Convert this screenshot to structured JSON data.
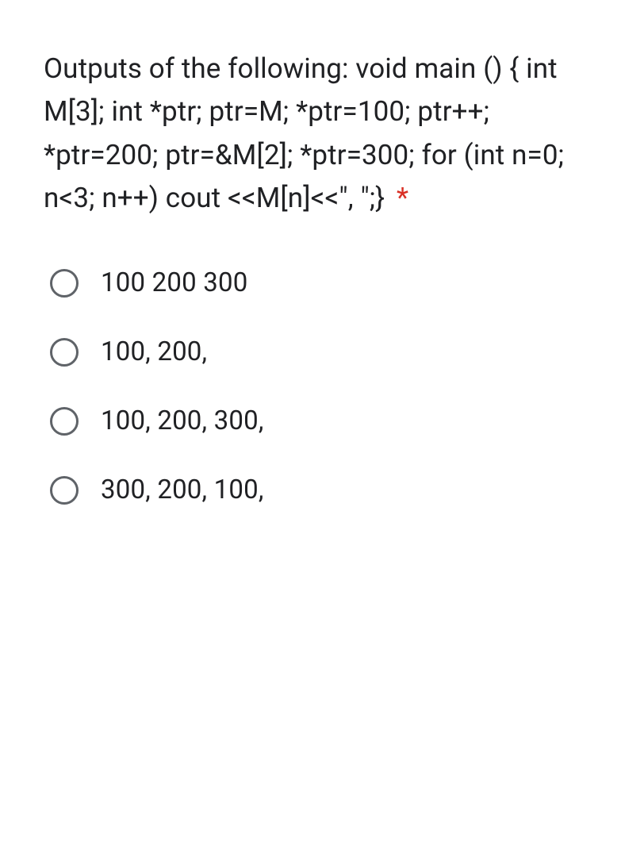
{
  "question": {
    "text": "Outputs of the following: void main () { int M[3]; int *ptr; ptr=M; *ptr=100; ptr++; *ptr=200; ptr=&M[2]; *ptr=300; for (int n=0; n<3; n++) cout <<M[n]<<\", \";}",
    "required_marker": "*"
  },
  "options": [
    {
      "label": "100 200 300"
    },
    {
      "label": "100, 200,"
    },
    {
      "label": "100, 200, 300,"
    },
    {
      "label": "300, 200, 100,"
    }
  ]
}
